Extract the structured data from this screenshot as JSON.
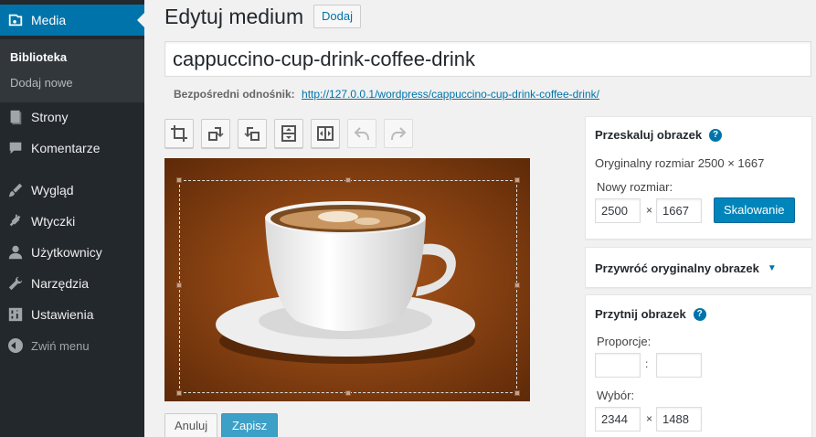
{
  "sidebar": {
    "media": "Media",
    "submenu": {
      "library": "Biblioteka",
      "add_new": "Dodaj nowe"
    },
    "items": [
      "Strony",
      "Komentarze",
      "Wygląd",
      "Wtyczki",
      "Użytkownicy",
      "Narzędzia",
      "Ustawienia"
    ],
    "collapse": "Zwiń menu"
  },
  "header": {
    "title": "Edytuj medium",
    "add_button": "Dodaj"
  },
  "title_value": "cappuccino-cup-drink-coffee-drink",
  "permalink": {
    "label": "Bezpośredni odnośnik:",
    "url": "http://127.0.0.1/wordpress/cappuccino-cup-drink-coffee-drink/"
  },
  "toolbar_icons": [
    "crop-icon",
    "rotate-left-icon",
    "rotate-right-icon",
    "flip-vertical-icon",
    "flip-horizontal-icon",
    "undo-icon",
    "redo-icon"
  ],
  "buttons": {
    "cancel": "Anuluj",
    "save": "Zapisz"
  },
  "scale_panel": {
    "title": "Przeskaluj obrazek",
    "original_size": "Oryginalny rozmiar 2500 × 1667",
    "new_size_label": "Nowy rozmiar:",
    "width": "2500",
    "height": "1667",
    "times": "×",
    "button": "Skalowanie"
  },
  "restore_panel": {
    "title": "Przywróć oryginalny obrazek"
  },
  "crop_panel": {
    "title": "Przytnij obrazek",
    "aspect_label": "Proporcje:",
    "colon": ":",
    "selection_label": "Wybór:",
    "sel_width": "2344",
    "sel_height": "1488",
    "times": "×"
  },
  "colors": {
    "sidebar_bg": "#23282d",
    "accent": "#0073aa",
    "button_primary": "#0085ba",
    "image_bg": "#7a3a10"
  }
}
